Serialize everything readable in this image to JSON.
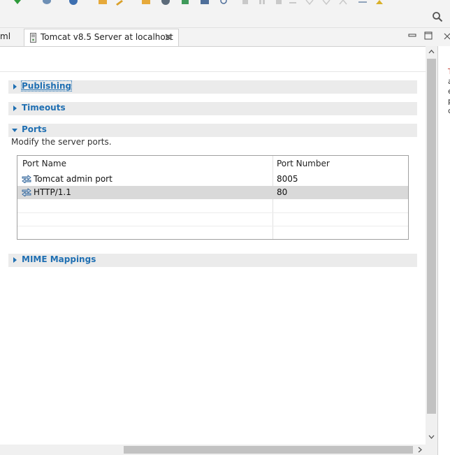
{
  "toolbar": {
    "icons": [
      "run-icon",
      "publish-icon",
      "external-tools-icon",
      "open-folder-icon",
      "wrench-icon",
      "open-type-icon",
      "globe-icon",
      "run-config-icon",
      "monitor-icon",
      "search-small-icon",
      "resume-icon",
      "suspend-icon",
      "stop-icon",
      "disconnect-icon",
      "step-into-icon",
      "step-over-icon",
      "step-return-icon",
      "drop-to-frame-icon",
      "bookmark-icon"
    ],
    "search_icon": "search-icon"
  },
  "tabs": {
    "previous_tab_label": "ml",
    "active_tab_label": "Tomcat v8.5 Server at localhost"
  },
  "sections": {
    "publishing": "Publishing",
    "timeouts": "Timeouts",
    "ports": "Ports",
    "mime": "MIME Mappings"
  },
  "ports": {
    "description": "Modify the server ports.",
    "columns": [
      "Port Name",
      "Port Number"
    ],
    "rows": [
      {
        "name": "Tomcat admin port",
        "number": "8005"
      },
      {
        "name": "HTTP/1.1",
        "number": "80"
      }
    ]
  },
  "right_pane": {
    "lines": [
      "T",
      "a",
      "e",
      "p",
      "c"
    ]
  },
  "colors": {
    "link": "#1f6fb2",
    "section_bg": "#ebebeb",
    "selected_row": "#d9d9d9",
    "toolbar_bg": "#f3f3f3"
  }
}
